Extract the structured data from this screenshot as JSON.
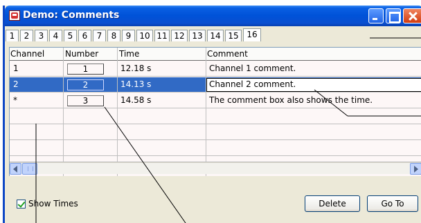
{
  "window": {
    "title": "Demo: Comments"
  },
  "tabs": [
    "1",
    "2",
    "3",
    "4",
    "5",
    "6",
    "7",
    "8",
    "9",
    "10",
    "11",
    "12",
    "13",
    "14",
    "15",
    "16"
  ],
  "active_tab": "16",
  "table": {
    "columns": [
      "Channel",
      "Number",
      "Time",
      "Comment"
    ],
    "rows": [
      {
        "channel": "1",
        "number": "1",
        "time": "12.18 s",
        "comment": "Channel 1 comment.",
        "selected": false
      },
      {
        "channel": "2",
        "number": "2",
        "time": "14.13 s",
        "comment": "Channel 2 comment.",
        "selected": true
      },
      {
        "channel": "*",
        "number": "3",
        "time": "14.58 s",
        "comment": "The comment box also shows the time.",
        "selected": false
      }
    ]
  },
  "options": {
    "show_times_label": "Show Times",
    "show_times_checked": true
  },
  "buttons": {
    "delete": "Delete",
    "goto": "Go To"
  },
  "colors": {
    "titlebar": "#0052d8",
    "selection": "#316ac5",
    "window_face": "#ece9d8"
  }
}
